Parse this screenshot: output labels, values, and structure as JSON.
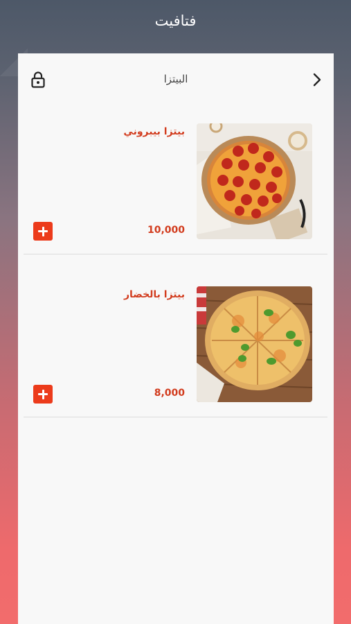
{
  "app": {
    "title": "فتافيت"
  },
  "category": {
    "title": "البيتزا"
  },
  "items": [
    {
      "name": "بيتزا بيبروني",
      "price": "10,000",
      "image": "pepperoni-pizza-photo"
    },
    {
      "name": "بيتزا بالخضار",
      "price": "8,000",
      "image": "vegetable-pizza-photo"
    }
  ],
  "icons": {
    "lock": "lock-icon",
    "back": "chevron-right-icon",
    "add": "plus-icon"
  },
  "colors": {
    "accent": "#ec3b1b",
    "price_text": "#d23c1e",
    "panel": "#f8f8f8"
  }
}
